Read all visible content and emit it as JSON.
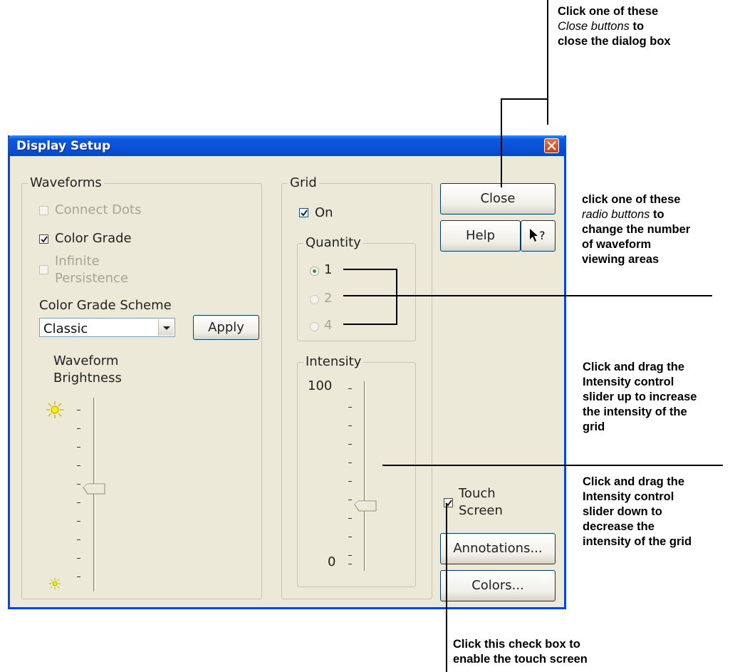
{
  "dialog": {
    "title": "Display Setup",
    "waveforms": {
      "legend": "Waveforms",
      "connect_dots": "Connect Dots",
      "color_grade": "Color Grade",
      "infinite_line1": "Infinite",
      "infinite_line2": "Persistence",
      "scheme_label": "Color Grade Scheme",
      "scheme_value": "Classic",
      "apply": "Apply",
      "brightness_line1": "Waveform",
      "brightness_line2": "Brightness"
    },
    "grid": {
      "legend": "Grid",
      "on_label": "On",
      "quantity_legend": "Quantity",
      "options": [
        "1",
        "2",
        "4"
      ],
      "intensity_legend": "Intensity",
      "intensity_max": "100",
      "intensity_min": "0"
    },
    "buttons": {
      "close": "Close",
      "help": "Help",
      "annotations": "Annotations...",
      "colors": "Colors..."
    },
    "touch_line1": "Touch",
    "touch_line2": "Screen"
  },
  "callouts": {
    "close_bold_1": "Click one of these",
    "close_italic": "Close buttons",
    "close_bold_2": " to",
    "close_bold_3": "close the dialog box",
    "radio_bold_1": "click one of these",
    "radio_italic": "radio buttons",
    "radio_bold_2": " to",
    "radio_bold_3": "change the number",
    "radio_bold_4": "of waveform",
    "radio_bold_5": "viewing areas",
    "up_1": "Click and drag the",
    "up_2": "Intensity control",
    "up_3": "slider up to increase",
    "up_4": "the intensity of the",
    "up_5": "grid",
    "down_1": "Click and drag the",
    "down_2": "Intensity control",
    "down_3": "slider down to",
    "down_4": "decrease the",
    "down_5": "intensity of the grid",
    "touch_1": "Click this check box to",
    "touch_2": "enable the touch screen"
  },
  "colors": {
    "titlebar": "#0a50d8",
    "dialog_bg": "#ece9d8",
    "close_x": "#d9532c",
    "radio_dot": "#21a121"
  },
  "state": {
    "color_grade_checked": true,
    "connect_dots_enabled": false,
    "infinite_persistence_enabled": false,
    "grid_on_checked": true,
    "grid_quantity_selected": "1",
    "touch_screen_checked": true,
    "waveform_brightness_level": 0.44,
    "grid_intensity_level": 0.34
  }
}
